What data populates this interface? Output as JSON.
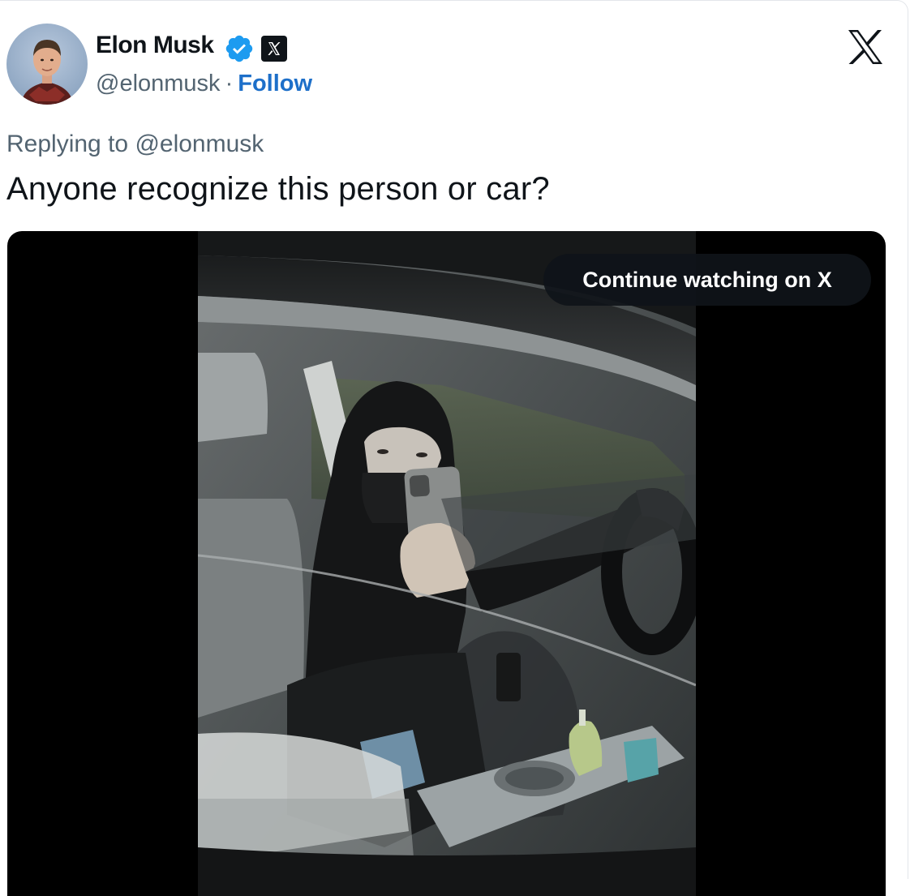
{
  "author": {
    "name": "Elon Musk",
    "handle": "@elonmusk",
    "separator": "·",
    "follow_label": "Follow",
    "verified_color": "#1d9bf0"
  },
  "icons": {
    "avatar": "avatar",
    "verified": "verified-badge-icon",
    "affiliation": "x-badge-icon",
    "logo": "x-logo-icon"
  },
  "tweet": {
    "reply_prefix": "Replying to",
    "reply_handle": "@elonmusk",
    "text": "Anyone recognize this person or car?"
  },
  "media": {
    "overlay_label": "Continue watching on X"
  },
  "colors": {
    "text": "#0f1419",
    "secondary": "#536471",
    "link": "#1d6fc9",
    "media_bg": "#000000"
  }
}
